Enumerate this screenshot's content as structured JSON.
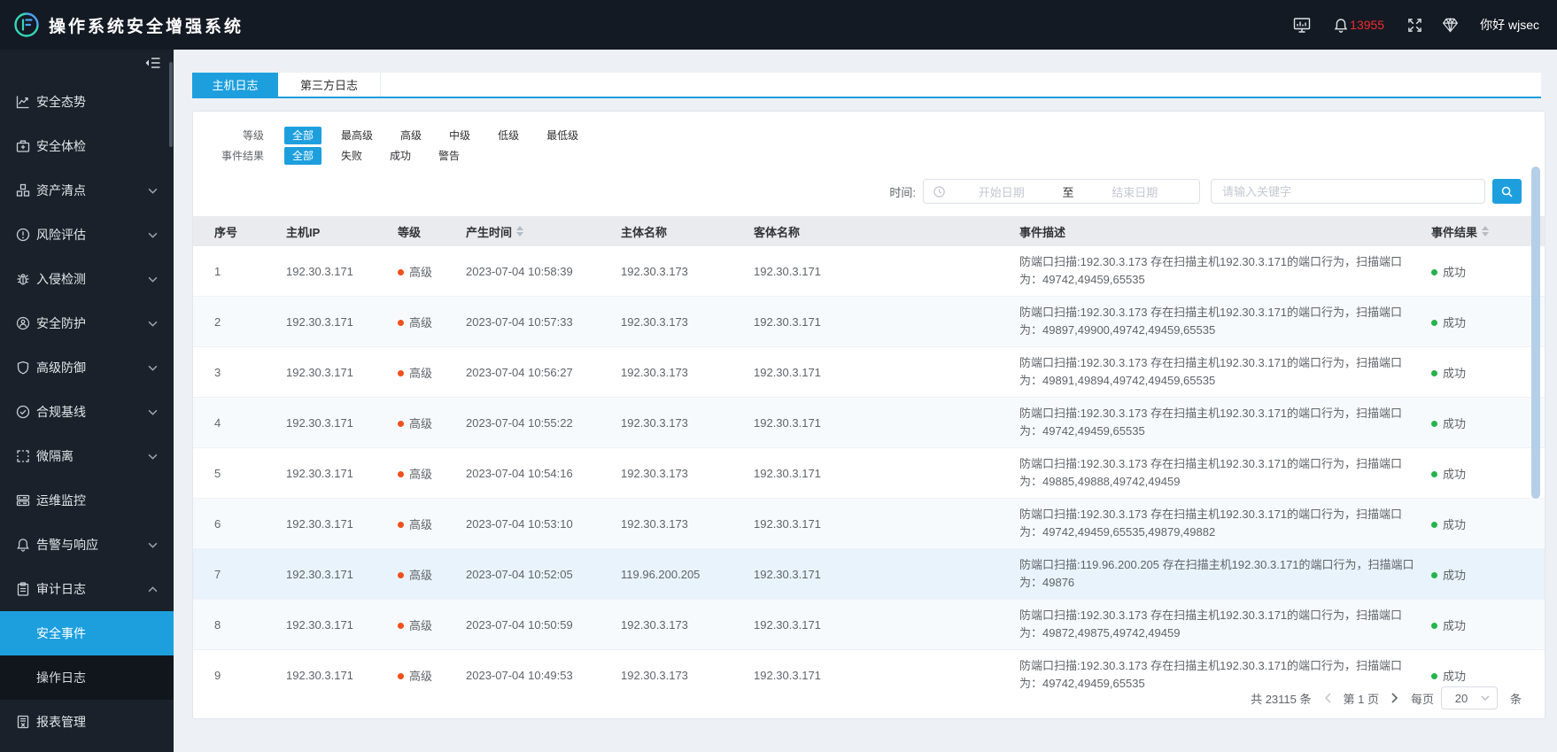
{
  "colors": {
    "accent": "#1d9fde",
    "level_dot": "#f0501c",
    "success_dot": "#26b34b",
    "badge_red": "#ef2b2b"
  },
  "topbar": {
    "title": "操作系统安全增强系统",
    "notification_count": "13955",
    "greeting": "你好 wjsec",
    "icons": [
      "monitor-icon",
      "bell-icon",
      "fullscreen-icon",
      "gem-icon"
    ]
  },
  "sidebar": {
    "items": [
      {
        "key": "security-posture",
        "label": "安全态势",
        "icon": "trend-chart-icon"
      },
      {
        "key": "security-checkup",
        "label": "安全体检",
        "icon": "first-aid-icon"
      },
      {
        "key": "asset-inventory",
        "label": "资产清点",
        "icon": "cubes-icon",
        "arrow": "down"
      },
      {
        "key": "risk-assessment",
        "label": "风险评估",
        "icon": "warning-circle-icon",
        "arrow": "down"
      },
      {
        "key": "intrusion-detection",
        "label": "入侵检测",
        "icon": "bug-icon",
        "arrow": "down"
      },
      {
        "key": "security-protection",
        "label": "安全防护",
        "icon": "shield-user-icon",
        "arrow": "down"
      },
      {
        "key": "advanced-defense",
        "label": "高级防御",
        "icon": "shield-icon",
        "arrow": "down"
      },
      {
        "key": "compliance-baseline",
        "label": "合规基线",
        "icon": "check-circle-icon",
        "arrow": "down"
      },
      {
        "key": "micro-segmentation",
        "label": "微隔离",
        "icon": "isolation-icon",
        "arrow": "down"
      },
      {
        "key": "ops-monitoring",
        "label": "运维监控",
        "icon": "server-icon"
      },
      {
        "key": "alert-response",
        "label": "告警与响应",
        "icon": "alarm-bell-icon",
        "arrow": "down"
      },
      {
        "key": "audit-log",
        "label": "审计日志",
        "icon": "clipboard-icon",
        "arrow": "up",
        "children": [
          {
            "key": "security-event",
            "label": "安全事件",
            "active": true
          },
          {
            "key": "operation-log",
            "label": "操作日志",
            "active": false
          }
        ]
      },
      {
        "key": "report-management",
        "label": "报表管理",
        "icon": "report-icon"
      }
    ]
  },
  "tabs": {
    "items": [
      {
        "key": "host-log",
        "label": "主机日志",
        "active": true
      },
      {
        "key": "third-party-log",
        "label": "第三方日志",
        "active": false
      }
    ]
  },
  "filters": {
    "rows": [
      {
        "label": "等级",
        "selected": "全部",
        "options": [
          "全部",
          "最高级",
          "高级",
          "中级",
          "低级",
          "最低级"
        ]
      },
      {
        "label": "事件结果",
        "selected": "全部",
        "options": [
          "全部",
          "失败",
          "成功",
          "警告"
        ]
      }
    ]
  },
  "search": {
    "time_label": "时间:",
    "start_placeholder": "开始日期",
    "range_separator": "至",
    "end_placeholder": "结束日期",
    "keyword_placeholder": "请输入关键字"
  },
  "table": {
    "columns": [
      {
        "label": "序号"
      },
      {
        "label": "主机IP"
      },
      {
        "label": "等级"
      },
      {
        "label": "产生时间",
        "sortable": true
      },
      {
        "label": "主体名称"
      },
      {
        "label": "客体名称"
      },
      {
        "label": "事件描述"
      },
      {
        "label": "事件结果",
        "sortable": true
      }
    ],
    "rows": [
      {
        "no": "1",
        "host_ip": "192.30.3.171",
        "level": "高级",
        "time": "2023-07-04 10:58:39",
        "subject": "192.30.3.173",
        "object": "192.30.3.171",
        "description": "防端口扫描:192.30.3.173 存在扫描主机192.30.3.171的端口行为，扫描端口为：49742,49459,65535",
        "result": "成功"
      },
      {
        "no": "2",
        "host_ip": "192.30.3.171",
        "level": "高级",
        "time": "2023-07-04 10:57:33",
        "subject": "192.30.3.173",
        "object": "192.30.3.171",
        "description": "防端口扫描:192.30.3.173 存在扫描主机192.30.3.171的端口行为，扫描端口为：49897,49900,49742,49459,65535",
        "result": "成功"
      },
      {
        "no": "3",
        "host_ip": "192.30.3.171",
        "level": "高级",
        "time": "2023-07-04 10:56:27",
        "subject": "192.30.3.173",
        "object": "192.30.3.171",
        "description": "防端口扫描:192.30.3.173 存在扫描主机192.30.3.171的端口行为，扫描端口为：49891,49894,49742,49459,65535",
        "result": "成功"
      },
      {
        "no": "4",
        "host_ip": "192.30.3.171",
        "level": "高级",
        "time": "2023-07-04 10:55:22",
        "subject": "192.30.3.173",
        "object": "192.30.3.171",
        "description": "防端口扫描:192.30.3.173 存在扫描主机192.30.3.171的端口行为，扫描端口为：49742,49459,65535",
        "result": "成功"
      },
      {
        "no": "5",
        "host_ip": "192.30.3.171",
        "level": "高级",
        "time": "2023-07-04 10:54:16",
        "subject": "192.30.3.173",
        "object": "192.30.3.171",
        "description": "防端口扫描:192.30.3.173 存在扫描主机192.30.3.171的端口行为，扫描端口为：49885,49888,49742,49459",
        "result": "成功"
      },
      {
        "no": "6",
        "host_ip": "192.30.3.171",
        "level": "高级",
        "time": "2023-07-04 10:53:10",
        "subject": "192.30.3.173",
        "object": "192.30.3.171",
        "description": "防端口扫描:192.30.3.173 存在扫描主机192.30.3.171的端口行为，扫描端口为：49742,49459,65535,49879,49882",
        "result": "成功"
      },
      {
        "no": "7",
        "host_ip": "192.30.3.171",
        "level": "高级",
        "time": "2023-07-04 10:52:05",
        "subject": "119.96.200.205",
        "object": "192.30.3.171",
        "description": "防端口扫描:119.96.200.205 存在扫描主机192.30.3.171的端口行为，扫描端口为：49876",
        "result": "成功",
        "highlight": true
      },
      {
        "no": "8",
        "host_ip": "192.30.3.171",
        "level": "高级",
        "time": "2023-07-04 10:50:59",
        "subject": "192.30.3.173",
        "object": "192.30.3.171",
        "description": "防端口扫描:192.30.3.173 存在扫描主机192.30.3.171的端口行为，扫描端口为：49872,49875,49742,49459",
        "result": "成功"
      },
      {
        "no": "9",
        "host_ip": "192.30.3.171",
        "level": "高级",
        "time": "2023-07-04 10:49:53",
        "subject": "192.30.3.173",
        "object": "192.30.3.171",
        "description": "防端口扫描:192.30.3.173 存在扫描主机192.30.3.171的端口行为，扫描端口为：49742,49459,65535",
        "result": "成功"
      }
    ]
  },
  "pagination": {
    "total": "共 23115 条",
    "page_label": "第 1 页",
    "per_page_label": "每页",
    "per_page_value": "20",
    "unit_label": "条"
  }
}
